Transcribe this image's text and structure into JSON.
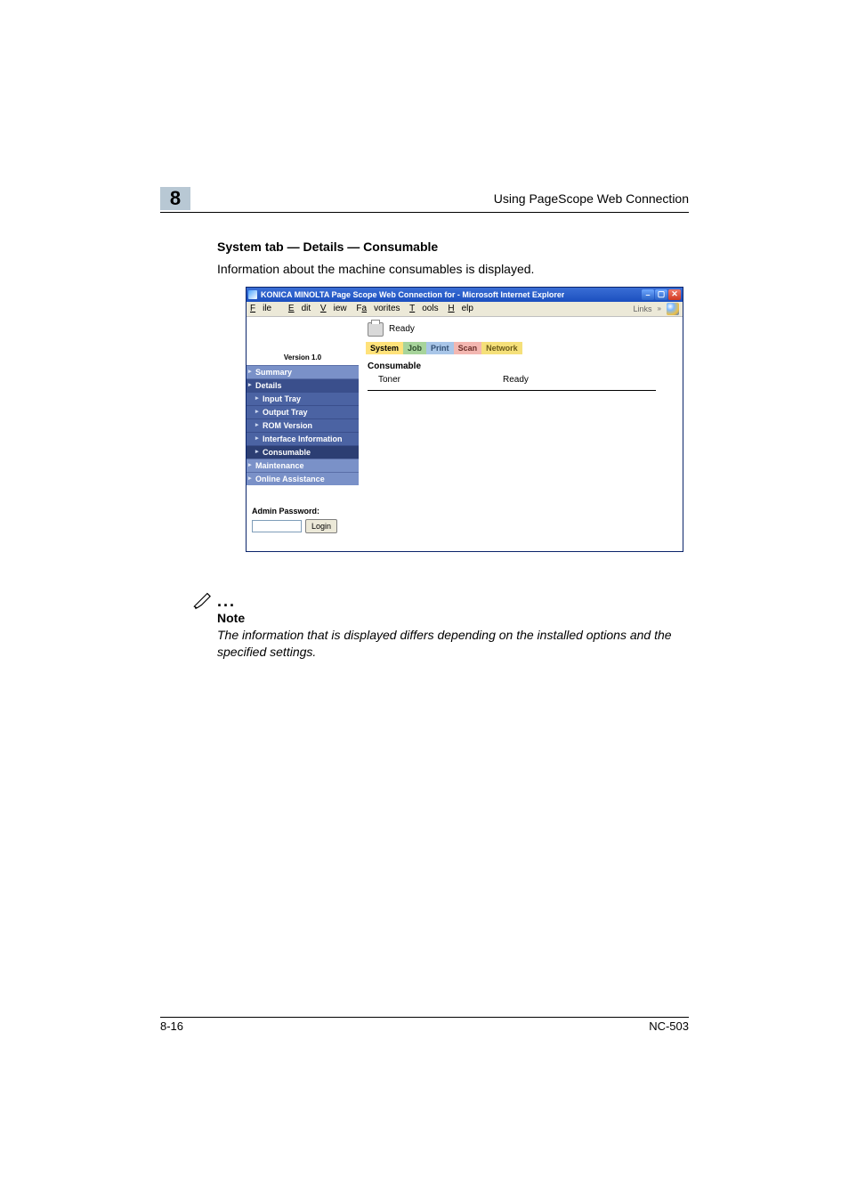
{
  "page_header": {
    "chapter": "8",
    "right": "Using PageScope Web Connection"
  },
  "section_title": "System tab — Details — Consumable",
  "intro_text": "Information about the machine consumables is displayed.",
  "browser": {
    "title": "KONICA MINOLTA Page Scope Web Connection for      - Microsoft Internet Explorer",
    "menu": {
      "file": "File",
      "edit": "Edit",
      "view": "View",
      "favorites": "Favorites",
      "tools": "Tools",
      "help": "Help",
      "links": "Links"
    },
    "sidebar": {
      "version": "Version 1.0",
      "items": {
        "summary": "Summary",
        "details": "Details",
        "maintenance": "Maintenance",
        "online_assistance": "Online Assistance"
      },
      "sub_items": {
        "input_tray": "Input Tray",
        "output_tray": "Output Tray",
        "rom_version": "ROM Version",
        "interface_info": "Interface Information",
        "consumable": "Consumable"
      },
      "admin": {
        "label": "Admin Password:",
        "login": "Login"
      }
    },
    "main": {
      "status": "Ready",
      "tabs": {
        "system": "System",
        "job": "Job",
        "print": "Print",
        "scan": "Scan",
        "network": "Network"
      },
      "section": "Consumable",
      "row": {
        "label": "Toner",
        "value": "Ready"
      }
    }
  },
  "note": {
    "label": "Note",
    "text": "The information that is displayed differs depending on the installed options and the specified settings."
  },
  "footer": {
    "left": "8-16",
    "right": "NC-503"
  }
}
